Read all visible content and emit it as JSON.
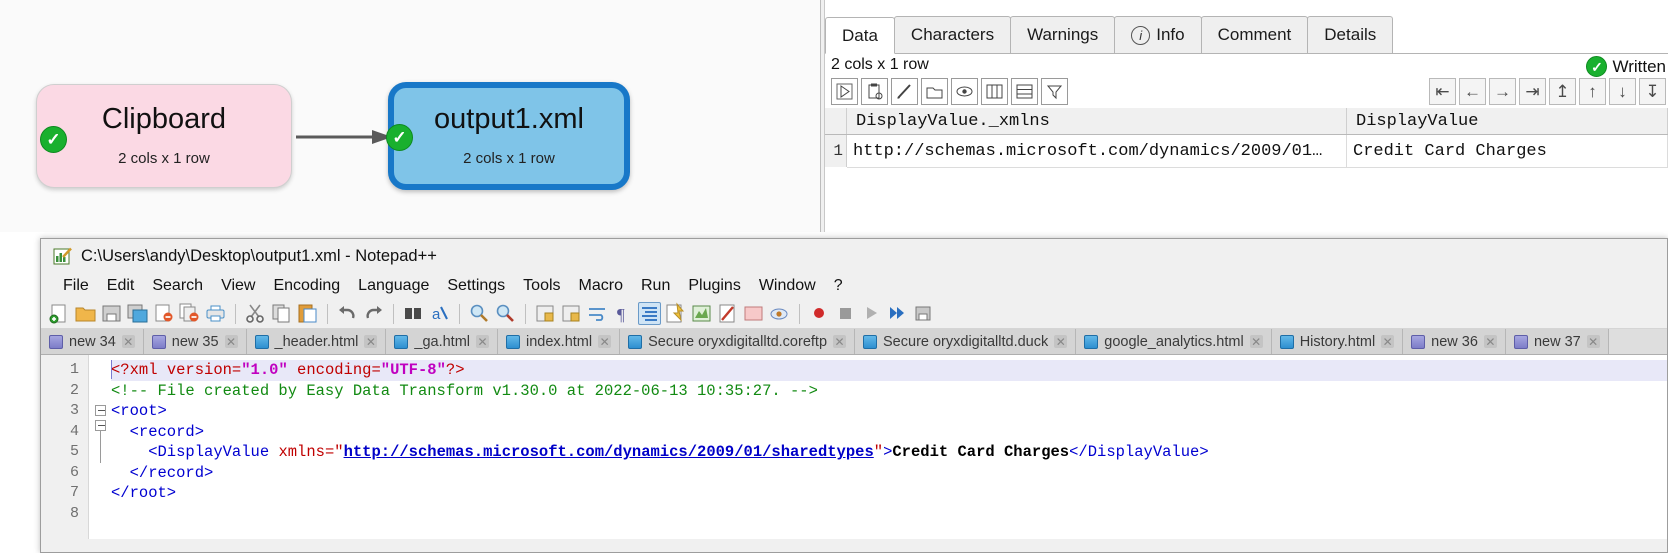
{
  "canvas": {
    "nodes": [
      {
        "name": "node-clipboard",
        "title": "Clipboard",
        "subtitle": "2 cols x 1 row",
        "status_icon": "check-icon",
        "status": "✓",
        "fill": "#fbd9e4"
      },
      {
        "name": "node-output",
        "title": "output1.xml",
        "subtitle": "2 cols x 1 row",
        "status_icon": "check-icon",
        "status": "✓",
        "fill": "#7fc4e8",
        "border": "#1878c8"
      }
    ],
    "connector": "arrow-right"
  },
  "data_panel": {
    "tabs": [
      {
        "label": "Data",
        "active": true,
        "icon": ""
      },
      {
        "label": "Characters",
        "active": false,
        "icon": ""
      },
      {
        "label": "Warnings",
        "active": false,
        "icon": ""
      },
      {
        "label": "Info",
        "active": false,
        "icon": "info-icon"
      },
      {
        "label": "Comment",
        "active": false,
        "icon": ""
      },
      {
        "label": "Details",
        "active": false,
        "icon": ""
      }
    ],
    "dimensions": "2 cols x 1 row",
    "status": {
      "icon": "check-icon",
      "mark": "✓",
      "label": "Written",
      "color": "#19b02e"
    },
    "grid_toolbar": [
      {
        "name": "run-icon",
        "glyph": "▷"
      },
      {
        "name": "paste-clipboard-icon",
        "glyph": "⎘"
      },
      {
        "name": "edit-pencil-icon",
        "glyph": "✐"
      },
      {
        "name": "folder-icon",
        "glyph": "▭"
      },
      {
        "name": "eye-icon",
        "glyph": "◉"
      },
      {
        "name": "columns-icon",
        "glyph": "▥"
      },
      {
        "name": "rows-icon",
        "glyph": "▤"
      },
      {
        "name": "filter-icon",
        "glyph": "▽"
      }
    ],
    "nav_toolbar": [
      {
        "name": "first-column-icon",
        "glyph": "⇤"
      },
      {
        "name": "previous-column-icon",
        "glyph": "←"
      },
      {
        "name": "next-column-icon",
        "glyph": "→"
      },
      {
        "name": "last-column-icon",
        "glyph": "⇥"
      },
      {
        "name": "first-row-icon",
        "glyph": "↥"
      },
      {
        "name": "previous-row-icon",
        "glyph": "↑"
      },
      {
        "name": "next-row-icon",
        "glyph": "↓"
      },
      {
        "name": "last-row-icon",
        "glyph": "↧"
      }
    ],
    "grid": {
      "columns": [
        "DisplayValue._xmlns",
        "DisplayValue"
      ],
      "rows": [
        {
          "number": "1",
          "cells": [
            "http://schemas.microsoft.com/dynamics/2009/01…",
            "Credit Card Charges"
          ]
        }
      ]
    }
  },
  "notepad": {
    "title": "C:\\Users\\andy\\Desktop\\output1.xml - Notepad++",
    "window_icon": "notepad-plus-plus-icon",
    "menu": [
      "File",
      "Edit",
      "Search",
      "View",
      "Encoding",
      "Language",
      "Settings",
      "Tools",
      "Macro",
      "Run",
      "Plugins",
      "Window",
      "?"
    ],
    "toolbar_icons": [
      "new-document-icon",
      "open-folder-icon",
      "save-icon",
      "save-all-icon",
      "close-document-icon",
      "close-all-documents-icon",
      "print-icon",
      "cut-icon",
      "copy-icon",
      "paste-icon",
      "undo-icon",
      "redo-icon",
      "find-icon",
      "replace-icon",
      "zoom-in-icon",
      "zoom-out-icon",
      "sync-vertical-scrolling-icon",
      "sync-horizontal-scrolling-icon",
      "word-wrap-icon",
      "show-all-characters-icon",
      "indent-guide-icon",
      "user-defined-language-icon",
      "document-map-icon",
      "function-list-icon",
      "folder-as-workspace-icon",
      "monitoring-icon",
      "record-macro-icon",
      "stop-recording-icon",
      "play-macro-icon",
      "run-macro-multiple-icon",
      "save-macro-icon"
    ],
    "file_tabs": [
      {
        "label": "new 34",
        "icon": "save-icon-purple",
        "close": "close-icon"
      },
      {
        "label": "new 35",
        "icon": "save-icon-purple",
        "close": "close-icon"
      },
      {
        "label": "_header.html",
        "icon": "save-icon-blue",
        "close": "close-icon"
      },
      {
        "label": "_ga.html",
        "icon": "save-icon-blue",
        "close": "close-icon"
      },
      {
        "label": "index.html",
        "icon": "save-icon-blue",
        "close": "close-icon"
      },
      {
        "label": "Secure oryxdigitalltd.coreftp",
        "icon": "save-icon-blue",
        "close": "close-icon"
      },
      {
        "label": "Secure oryxdigitalltd.duck",
        "icon": "save-icon-blue",
        "close": "close-icon"
      },
      {
        "label": "google_analytics.html",
        "icon": "save-icon-blue",
        "close": "close-icon"
      },
      {
        "label": "History.html",
        "icon": "save-icon-blue",
        "close": "close-icon"
      },
      {
        "label": "new 36",
        "icon": "save-icon-purple",
        "close": "close-icon"
      },
      {
        "label": "new 37",
        "icon": "save-icon-purple",
        "close": "close-icon"
      }
    ],
    "line_numbers": [
      "1",
      "2",
      "3",
      "4",
      "5",
      "6",
      "7",
      "8"
    ],
    "code": {
      "line1": {
        "pi_open": "<?xml ",
        "attr1": "version=",
        "val1": "\"1.0\"",
        "attr2": " encoding=",
        "val2": "\"UTF-8\"",
        "pi_close": "?>"
      },
      "line2": "<!-- File created by Easy Data Transform v1.30.0 at 2022-06-13 10:35:27. -->",
      "line3": "<root>",
      "line4": "  <record>",
      "line5": {
        "tag_open": "    <DisplayValue ",
        "attr": "xmlns=",
        "quote_open": "\"",
        "url": "http://schemas.microsoft.com/dynamics/2009/01/sharedtypes",
        "quote_close": "\"",
        "gt": ">",
        "text": "Credit Card Charges",
        "tag_close": "</DisplayValue>"
      },
      "line6": "  </record>",
      "line7": "</root>"
    }
  }
}
